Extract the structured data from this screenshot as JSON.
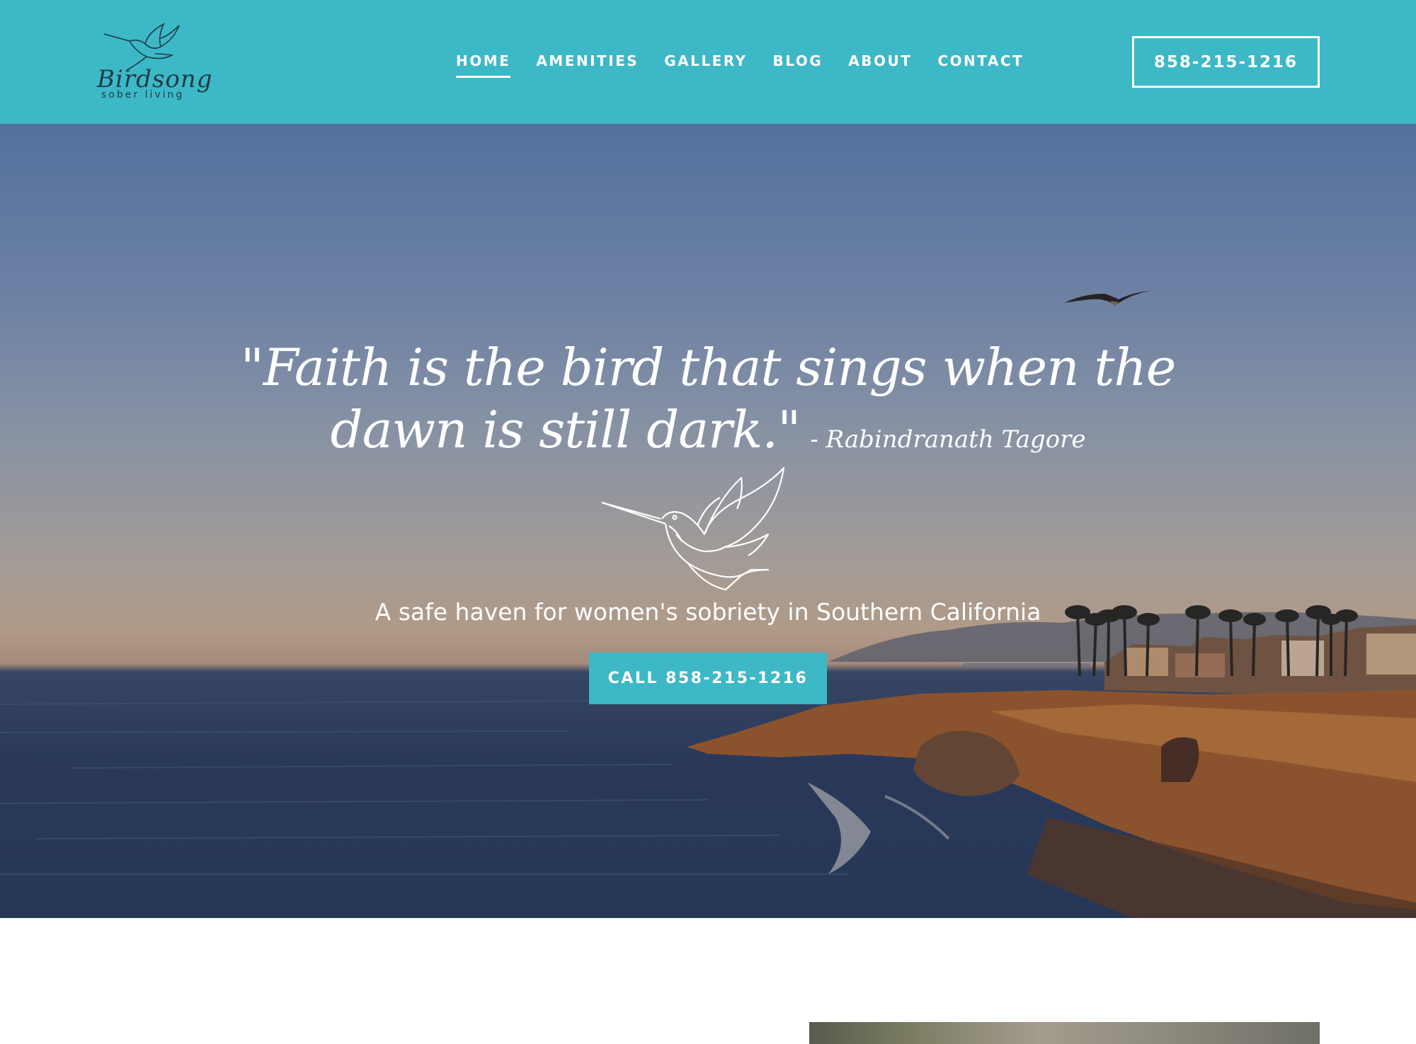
{
  "brand": {
    "name": "Birdsong",
    "subtitle": "sober living",
    "logo_icon": "hummingbird-icon",
    "accent_color": "#3db8c6"
  },
  "nav": {
    "items": [
      {
        "label": "HOME",
        "active": true
      },
      {
        "label": "AMENITIES",
        "active": false
      },
      {
        "label": "GALLERY",
        "active": false
      },
      {
        "label": "BLOG",
        "active": false
      },
      {
        "label": "ABOUT",
        "active": false
      },
      {
        "label": "CONTACT",
        "active": false
      }
    ],
    "phone_button": "858-215-1216"
  },
  "hero": {
    "quote_line1": "\"Faith is the bird that sings when the",
    "quote_line2": "dawn is still dark.\"",
    "quote_author": "- Rabindranath Tagore",
    "bird_icon": "hummingbird-line-icon",
    "tagline": "A safe haven for women's sobriety in Southern California",
    "cta_label": "CALL 858-215-1216"
  }
}
